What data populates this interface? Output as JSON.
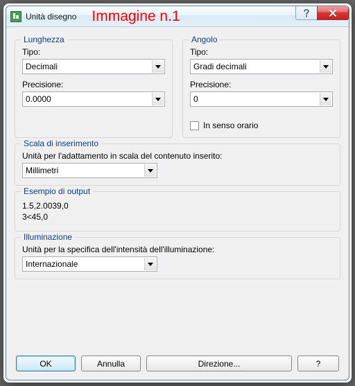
{
  "window": {
    "title": "Unità disegno",
    "annotation": "Immagine n.1"
  },
  "length": {
    "legend": "Lunghezza",
    "type_label": "Tipo:",
    "type_value": "Decimali",
    "precision_label": "Precisione:",
    "precision_value": "0.0000"
  },
  "angle": {
    "legend": "Angolo",
    "type_label": "Tipo:",
    "type_value": "Gradi decimali",
    "precision_label": "Precisione:",
    "precision_value": "0",
    "clockwise_label": "In senso orario",
    "clockwise_checked": false
  },
  "insertion": {
    "legend": "Scala di inserimento",
    "desc": "Unità per l'adattamento in scala del contenuto inserito:",
    "value": "Millimetri"
  },
  "sample": {
    "legend": "Esempio di output",
    "line1": "1.5,2.0039,0",
    "line2": "3<45,0"
  },
  "lighting": {
    "legend": "Illuminazione",
    "desc": "Unità per la specifica dell'intensità dell'illuminazione:",
    "value": "Internazionale"
  },
  "buttons": {
    "ok": "OK",
    "cancel": "Annulla",
    "direction": "Direzione...",
    "help": "?"
  }
}
